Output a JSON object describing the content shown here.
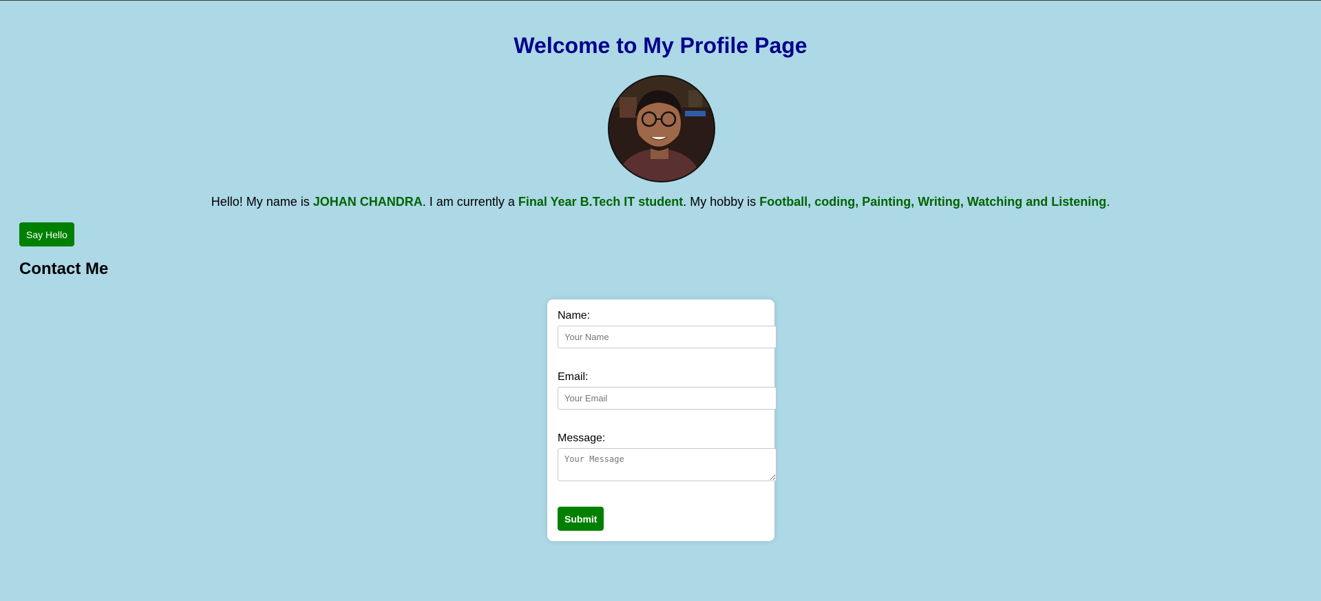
{
  "page": {
    "title": "Welcome to My Profile Page",
    "background_color": "#add8e6",
    "title_color": "#00008b",
    "highlight_color": "#006400",
    "button_color": "#008000"
  },
  "intro": {
    "prefix": "Hello! My name is ",
    "name": "JOHAN CHANDRA",
    "middle1": ". I am currently a ",
    "status": "Final Year B.Tech IT student",
    "middle2": ". My hobby is ",
    "hobbies": "Football, coding, Painting, Writing, Watching and Listening",
    "suffix": "."
  },
  "say_hello": {
    "label": "Say Hello"
  },
  "contact": {
    "heading": "Contact Me",
    "name_label": "Name:",
    "name_placeholder": "Your Name",
    "email_label": "Email:",
    "email_placeholder": "Your Email",
    "message_label": "Message:",
    "message_placeholder": "Your Message",
    "submit_label": "Submit"
  }
}
